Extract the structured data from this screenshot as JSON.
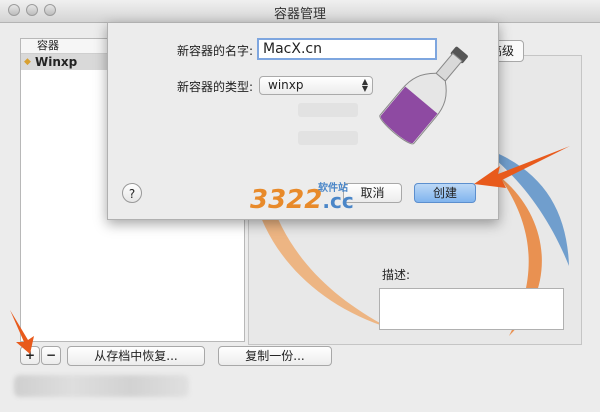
{
  "window": {
    "title": "容器管理"
  },
  "list": {
    "column_header": "容器",
    "items": [
      {
        "label": "Winxp"
      }
    ]
  },
  "buttons": {
    "add": "+",
    "remove": "−",
    "restore": "从存档中恢复...",
    "duplicate": "复制一份...",
    "advanced": "高级"
  },
  "description": {
    "label": "描述:"
  },
  "dialog": {
    "name_label": "新容器的名字:",
    "name_value": "MacX.cn",
    "type_label": "新容器的类型:",
    "type_value": "winxp",
    "help": "?",
    "cancel": "取消",
    "create": "创建"
  },
  "watermark": {
    "brand": "3322",
    "suffix": ".cc",
    "sub": "软件站"
  },
  "colors": {
    "accent": "#e85a1c",
    "bottle": "#8e4aa2",
    "wine": "#a0448c",
    "swoosh_orange": "#e87a2a",
    "swoosh_blue": "#5a90c8"
  }
}
